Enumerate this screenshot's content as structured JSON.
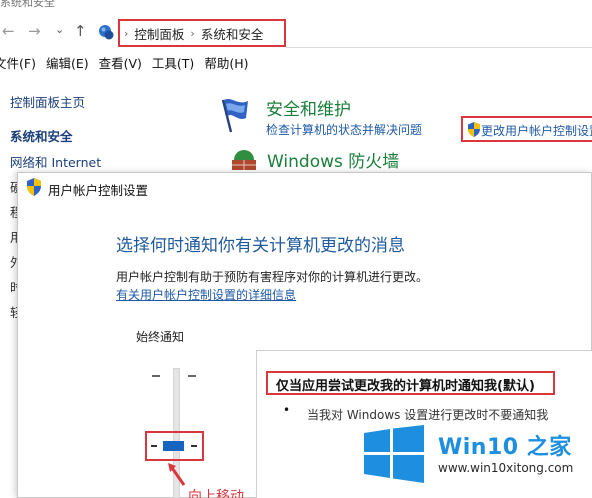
{
  "control_panel": {
    "window_title": "系统和安全",
    "nav": {
      "back_icon": "←",
      "forward_icon": "→",
      "recent_icon": "⌄",
      "up_icon": "↑"
    },
    "breadcrumb": [
      "控制面板",
      "系统和安全"
    ],
    "breadcrumb_sep": "›",
    "menu": [
      "文件(F)",
      "编辑(E)",
      "查看(V)",
      "工具(T)",
      "帮助(H)"
    ],
    "sidebar": {
      "home": "控制面板主页",
      "current": "系统和安全",
      "network": "网络和 Internet",
      "truncated": [
        "硬",
        "程",
        "用",
        "外",
        "时",
        "轻"
      ]
    },
    "security": {
      "title": "安全和维护",
      "link_status": "检查计算机的状态并解决问题",
      "link_uac": "更改用户帐户控制设置"
    },
    "firewall": {
      "title": "Windows 防火墙"
    }
  },
  "uac_dialog": {
    "title": "用户帐户控制设置",
    "heading": "选择何时通知你有关计算机更改的消息",
    "description": "用户帐户控制有助于预防有害程序对你的计算机进行更改。",
    "more_link": "有关用户帐户控制设置的详细信息",
    "slider_top_label": "始终通知",
    "slider_level": {
      "position": 3,
      "of": 4
    },
    "annotation": "向上移动",
    "info_title": "仅当应用尝试更改我的计算机时通知我(默认)",
    "info_bullet": "•",
    "info_text": "当我对 Windows 设置进行更改时不要通知我"
  },
  "watermark": {
    "brand": "Win10 之家",
    "url": "www.win10xitong.com"
  },
  "colors": {
    "highlight_red": "#d9363e",
    "link_blue": "#1f5aa6",
    "heading_green": "#1a7f3a",
    "slider_blue": "#1565c0",
    "brand_blue": "#1e8fde"
  }
}
